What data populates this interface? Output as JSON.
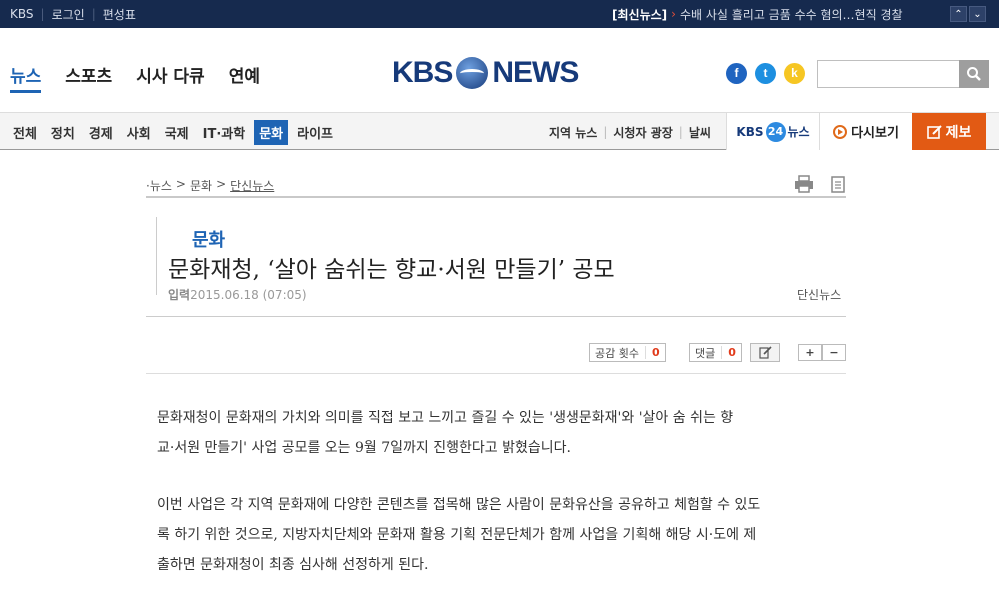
{
  "topbar": {
    "links": [
      "KBS",
      "로그인",
      "편성표"
    ],
    "ticker_label": "[최신뉴스]",
    "ticker_arrow": "›",
    "ticker_text": "수배 사실 흘리고 금품 수수 혐의…현직 경찰",
    "prev": "⌃",
    "next": "⌄"
  },
  "header": {
    "nav": [
      "뉴스",
      "스포츠",
      "시사 다큐",
      "연예"
    ],
    "logo_left": "KBS",
    "logo_right": "NEWS",
    "social": [
      "f",
      "t",
      "k"
    ],
    "search_placeholder": "",
    "search_icon": "search-icon"
  },
  "subnav": {
    "categories": [
      "전체",
      "정치",
      "경제",
      "사회",
      "국제",
      "IT·과학",
      "문화",
      "라이프"
    ],
    "active": "문화",
    "right_links": [
      "지역 뉴스",
      "시청자 광장",
      "날씨"
    ],
    "kbs24_pre": "KBS",
    "kbs24_num": "24",
    "kbs24_post": "뉴스",
    "replay": "다시보기",
    "report": "제보"
  },
  "article": {
    "breadcrumb": [
      "·뉴스",
      ">",
      "문화",
      ">",
      "단신뉴스"
    ],
    "section": "문화",
    "title": "문화재청, ‘살아 숨쉬는 향교·서원 만들기’ 공모",
    "date_label": "입력",
    "date": "2015.06.18 (07:05)",
    "source": "단신뉴스",
    "like_label": "공감 횟수",
    "like_count": "0",
    "comment_label": "댓글",
    "comment_count": "0",
    "font_plus": "+",
    "font_minus": "−",
    "paragraphs": [
      "문화재청이 문화재의 가치와 의미를 직접 보고 느끼고 즐길 수 있는 '생생문화재'와 '살아 숨 쉬는 향",
      "교·서원 만들기' 사업 공모를 오는 9월 7일까지 진행한다고 밝혔습니다.",
      "이번 사업은 각 지역 문화재에 다양한 콘텐츠를 접목해 많은 사람이 문화유산을 공유하고 체험할 수 있도",
      "록 하기 위한 것으로, 지방자치단체와 문화재 활용 기획 전문단체가 함께 사업을 기획해 해당 시·도에 제",
      "출하면 문화재청이 최종 심사해 선정하게 된다."
    ]
  }
}
